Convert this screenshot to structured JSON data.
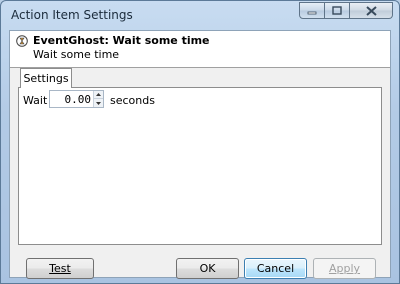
{
  "window": {
    "title": "Action Item Settings"
  },
  "header": {
    "title": "EventGhost: Wait some time",
    "description": "Wait some time"
  },
  "tabs": [
    {
      "label": "Settings"
    }
  ],
  "form": {
    "wait_label": "Wait",
    "wait_value": "0.00",
    "unit_label": "seconds"
  },
  "buttons": {
    "test": "Test",
    "ok": "OK",
    "cancel": "Cancel",
    "apply": "Apply"
  },
  "colors": {
    "accent": "#3c7fb1",
    "disabled_text": "#a0a0a0"
  }
}
